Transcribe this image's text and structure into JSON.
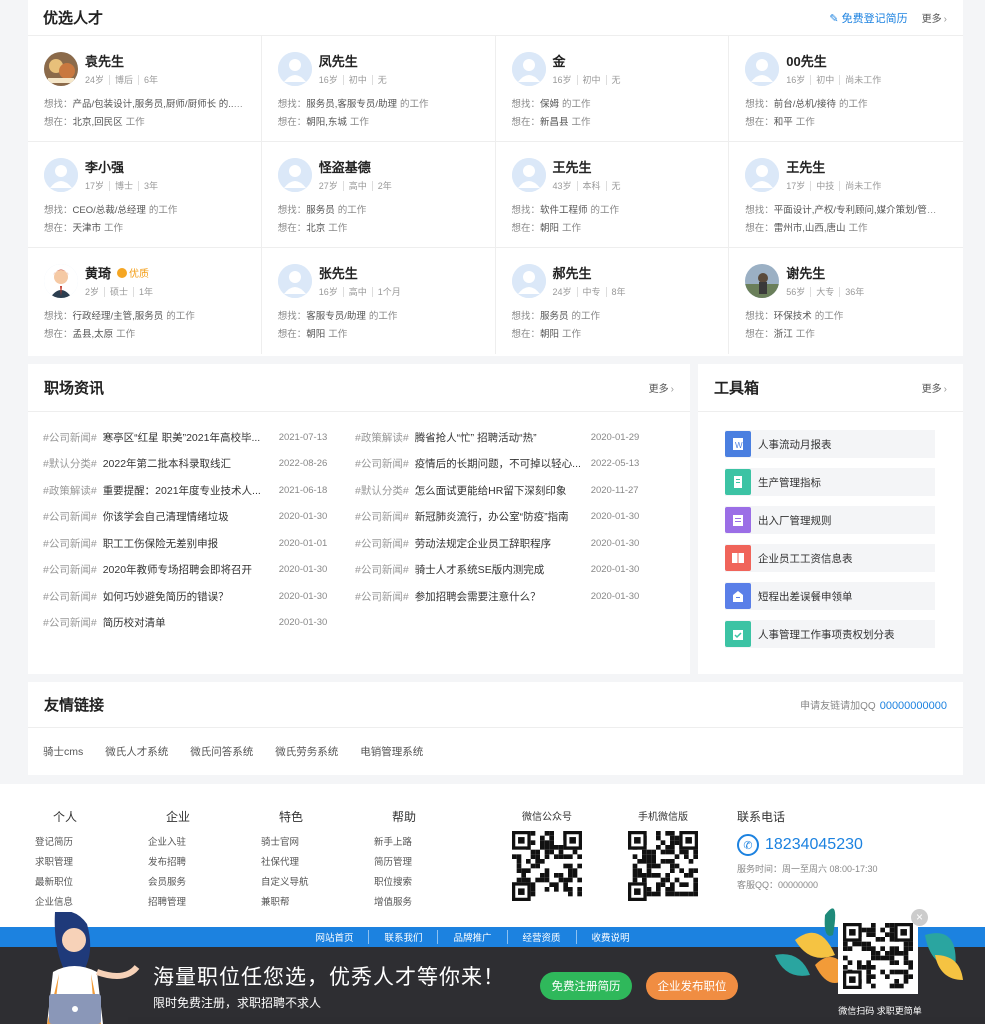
{
  "talents": {
    "title": "优选人才",
    "free_register": "免费登记简历",
    "more": "更多",
    "want_label": "想找：",
    "where_label": "想在：",
    "work_suffix": "的工作",
    "where_suffix": "工作",
    "items": [
      {
        "name": "袁先生",
        "badge": "",
        "age": "24岁",
        "edu": "博后",
        "exp": "6年",
        "job": "产品/包装设计,服务员,厨师/厨师长 的...",
        "place": "北京,回民区",
        "avatar": "photo-food"
      },
      {
        "name": "凤先生",
        "badge": "",
        "age": "16岁",
        "edu": "初中",
        "exp": "无",
        "job": "服务员,客服专员/助理",
        "place": "朝阳,东城",
        "avatar": "default"
      },
      {
        "name": "金",
        "badge": "",
        "age": "16岁",
        "edu": "初中",
        "exp": "无",
        "job": "保姆",
        "place": "新昌县",
        "avatar": "default"
      },
      {
        "name": "00先生",
        "badge": "",
        "age": "16岁",
        "edu": "初中",
        "exp": "尚未工作",
        "job": "前台/总机/接待",
        "place": "和平",
        "avatar": "default"
      },
      {
        "name": "李小强",
        "badge": "",
        "age": "17岁",
        "edu": "博士",
        "exp": "3年",
        "job": "CEO/总裁/总经理",
        "place": "天津市",
        "avatar": "default"
      },
      {
        "name": "怪盗基德",
        "badge": "",
        "age": "27岁",
        "edu": "高中",
        "exp": "2年",
        "job": "服务员",
        "place": "北京",
        "avatar": "default"
      },
      {
        "name": "王先生",
        "badge": "",
        "age": "43岁",
        "edu": "本科",
        "exp": "无",
        "job": "软件工程师",
        "place": "朝阳",
        "avatar": "default"
      },
      {
        "name": "王先生",
        "badge": "",
        "age": "17岁",
        "edu": "中技",
        "exp": "尚未工作",
        "job": "平面设计,产权/专利顾问,媒介策划/管理...",
        "place": "雷州市,山西,唐山",
        "avatar": "default"
      },
      {
        "name": "黄琦",
        "badge": "优质",
        "age": "2岁",
        "edu": "硕士",
        "exp": "1年",
        "job": "行政经理/主管,服务员",
        "place": "孟县,太原",
        "avatar": "cartoon-man"
      },
      {
        "name": "张先生",
        "badge": "",
        "age": "16岁",
        "edu": "高中",
        "exp": "1个月",
        "job": "客服专员/助理",
        "place": "朝阳",
        "avatar": "default"
      },
      {
        "name": "郝先生",
        "badge": "",
        "age": "24岁",
        "edu": "中专",
        "exp": "8年",
        "job": "服务员",
        "place": "朝阳",
        "avatar": "default"
      },
      {
        "name": "谢先生",
        "badge": "",
        "age": "56岁",
        "edu": "大专",
        "exp": "36年",
        "job": "环保技术",
        "place": "浙江",
        "avatar": "photo-outdoor"
      }
    ]
  },
  "news": {
    "title": "职场资讯",
    "more": "更多",
    "left": [
      {
        "cat": "#公司新闻#",
        "title": "寒亭区“红星 职美”2021年高校毕...",
        "date": "2021-07-13"
      },
      {
        "cat": "#默认分类#",
        "title": "2022年第二批本科录取线汇",
        "date": "2022-08-26"
      },
      {
        "cat": "#政策解读#",
        "title": "重要提醒：2021年度专业技术人...",
        "date": "2021-06-18"
      },
      {
        "cat": "#公司新闻#",
        "title": "你该学会自己清理情绪垃圾",
        "date": "2020-01-30"
      },
      {
        "cat": "#公司新闻#",
        "title": "职工工伤保险无差别申报",
        "date": "2020-01-01"
      },
      {
        "cat": "#公司新闻#",
        "title": "2020年教师专场招聘会即将召开",
        "date": "2020-01-30"
      },
      {
        "cat": "#公司新闻#",
        "title": "如何巧妙避免简历的错误？",
        "date": "2020-01-30"
      },
      {
        "cat": "#公司新闻#",
        "title": "简历校对清单",
        "date": "2020-01-30"
      }
    ],
    "right": [
      {
        "cat": "#政策解读#",
        "title": "腾省抢人“忙” 招聘活动“热”",
        "date": "2020-01-29"
      },
      {
        "cat": "#公司新闻#",
        "title": "疫情后的长期问题，不可掉以轻心...",
        "date": "2022-05-13"
      },
      {
        "cat": "#默认分类#",
        "title": "怎么面试更能给HR留下深刻印象",
        "date": "2020-11-27"
      },
      {
        "cat": "#公司新闻#",
        "title": "新冠肺炎流行，办公室“防疫”指南",
        "date": "2020-01-30"
      },
      {
        "cat": "#公司新闻#",
        "title": "劳动法规定企业员工辞职程序",
        "date": "2020-01-30"
      },
      {
        "cat": "#公司新闻#",
        "title": "骑士人才系统SE版内测完成",
        "date": "2020-01-30"
      },
      {
        "cat": "#公司新闻#",
        "title": "参加招聘会需要注意什么？",
        "date": "2020-01-30"
      }
    ]
  },
  "tools": {
    "title": "工具箱",
    "more": "更多",
    "items": [
      {
        "label": "人事流动月报表",
        "color": "#4a7fe0",
        "icon": "word-doc-icon"
      },
      {
        "label": "生产管理指标",
        "color": "#3cc3a4",
        "icon": "document-icon"
      },
      {
        "label": "出入厂管理规则",
        "color": "#9b6ee6",
        "icon": "clipboard-icon"
      },
      {
        "label": "企业员工工资信息表",
        "color": "#f0645a",
        "icon": "book-icon"
      },
      {
        "label": "短程出差误餐申领单",
        "color": "#5a7fe8",
        "icon": "form-icon"
      },
      {
        "label": "人事管理工作事项责权划分表",
        "color": "#3cc3a4",
        "icon": "calendar-check-icon"
      }
    ]
  },
  "links": {
    "title": "友情链接",
    "apply_text": "申请友链请加QQ",
    "apply_qq": "00000000000",
    "items": [
      "骑士cms",
      "微氏人才系统",
      "微氏问答系统",
      "微氏劳务系统",
      "电销管理系统"
    ]
  },
  "footer": {
    "cols": [
      {
        "title": "个人",
        "items": [
          "登记简历",
          "求职管理",
          "最新职位",
          "企业信息"
        ]
      },
      {
        "title": "企业",
        "items": [
          "企业入驻",
          "发布招聘",
          "会员服务",
          "招聘管理"
        ]
      },
      {
        "title": "特色",
        "items": [
          "骑士官网",
          "社保代理",
          "自定义导航",
          "兼职帮"
        ]
      },
      {
        "title": "帮助",
        "items": [
          "新手上路",
          "简历管理",
          "职位搜索",
          "增值服务"
        ]
      }
    ],
    "wechat_title": "微信公众号",
    "mobile_title": "手机微信版",
    "contact_title": "联系电话",
    "phone": "18234045230",
    "service_time": "服务时间：周一至周六 08:00-17:30",
    "service_qq": "客服QQ：00000000"
  },
  "navbar": [
    "网站首页",
    "联系我们",
    "品牌推广",
    "经营资质",
    "收费说明"
  ],
  "promo": {
    "title": "海量职位任您选，优秀人才等你来！",
    "subtitle": "限时免费注册，求职招聘不求人",
    "btn_resume": "免费注册简历",
    "btn_job": "企业发布职位",
    "qr_caption": "微信扫码 求职更简单",
    "close": "×"
  }
}
